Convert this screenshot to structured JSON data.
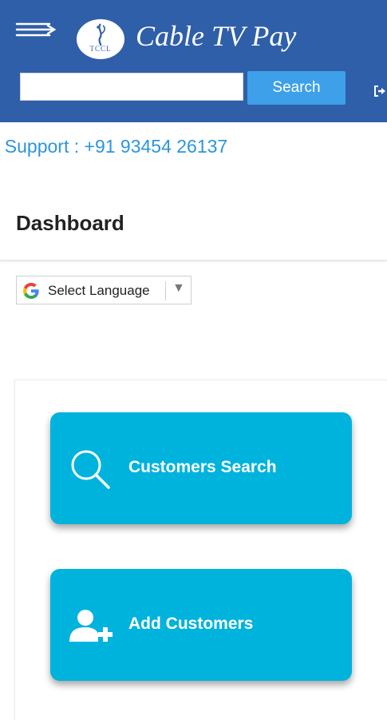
{
  "header": {
    "app_title": "Cable TV Pay",
    "logo_text": "TCCL",
    "menu_icon": "hamburger-menu-icon",
    "search": {
      "value": "",
      "placeholder": "",
      "button_label": "Search"
    },
    "logout_icon": "logout-icon",
    "background_color": "#2f5fa8",
    "search_button_color": "#3da0e8"
  },
  "support": {
    "text": "/ Support : +91 93454 26137",
    "color": "#2b95de"
  },
  "dashboard": {
    "title": "Dashboard"
  },
  "language_selector": {
    "label": "Select Language",
    "icon": "google-g-icon",
    "arrow": "▼"
  },
  "tiles": [
    {
      "label": "Customers Search",
      "icon": "search-icon"
    },
    {
      "label": "Add Customers",
      "icon": "add-user-icon"
    }
  ],
  "tile_color": "#00b3dd"
}
